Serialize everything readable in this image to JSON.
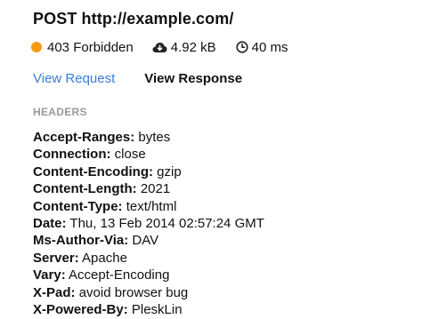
{
  "request": {
    "method": "POST",
    "url": "http://example.com/"
  },
  "meta": {
    "status": "403 Forbidden",
    "status_color": "#f59a14",
    "size": "4.92 kB",
    "size_icon": "cloud-download-icon",
    "time": "40 ms",
    "time_icon": "clock-icon"
  },
  "tabs": {
    "request_label": "View Request",
    "response_label": "View Response",
    "active": "response",
    "link_color": "#3b7dd8"
  },
  "headers_section": {
    "heading": "HEADERS",
    "items": [
      {
        "name": "Accept-Ranges:",
        "value": "bytes"
      },
      {
        "name": "Connection:",
        "value": "close"
      },
      {
        "name": "Content-Encoding:",
        "value": "gzip"
      },
      {
        "name": "Content-Length:",
        "value": "2021"
      },
      {
        "name": "Content-Type:",
        "value": "text/html"
      },
      {
        "name": "Date:",
        "value": "Thu, 13 Feb 2014 02:57:24 GMT"
      },
      {
        "name": "Ms-Author-Via:",
        "value": "DAV"
      },
      {
        "name": "Server:",
        "value": "Apache"
      },
      {
        "name": "Vary:",
        "value": "Accept-Encoding"
      },
      {
        "name": "X-Pad:",
        "value": "avoid browser bug"
      },
      {
        "name": "X-Powered-By:",
        "value": "PleskLin"
      }
    ]
  }
}
